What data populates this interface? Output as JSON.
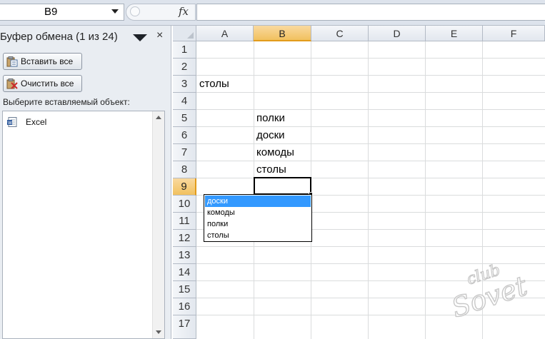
{
  "formula_bar": {
    "namebox_value": "B9",
    "fx_label": "fx",
    "formula_value": ""
  },
  "clipboard": {
    "title": "Буфер обмена (1 из 24)",
    "close_glyph": "×",
    "paste_all_label": "Вставить все",
    "clear_all_label": "Очистить все",
    "prompt": "Выберите вставляемый объект:",
    "items": [
      {
        "label": "Excel",
        "icon": "word-doc-icon"
      }
    ]
  },
  "grid": {
    "columns": [
      "A",
      "B",
      "C",
      "D",
      "E",
      "F"
    ],
    "selected_column": "B",
    "rows": [
      "1",
      "2",
      "3",
      "4",
      "5",
      "6",
      "7",
      "8",
      "9",
      "10",
      "11",
      "12",
      "13",
      "14",
      "15",
      "16",
      "17"
    ],
    "selected_row": "9",
    "cells": {
      "A3": "столы",
      "B5": "полки",
      "B6": "доски",
      "B7": "комоды",
      "B8": "столы"
    },
    "active_cell": "B9"
  },
  "autocomplete": {
    "items": [
      "доски",
      "комоды",
      "полки",
      "столы"
    ],
    "selected_index": 0
  },
  "watermark": {
    "line1": "club",
    "line2": "Sovet"
  },
  "colors": {
    "header_selected": "#f1c15f",
    "autocomplete_selected": "#3399ff",
    "pane_background": "#e9edf2",
    "gridline": "#dadcdd"
  }
}
